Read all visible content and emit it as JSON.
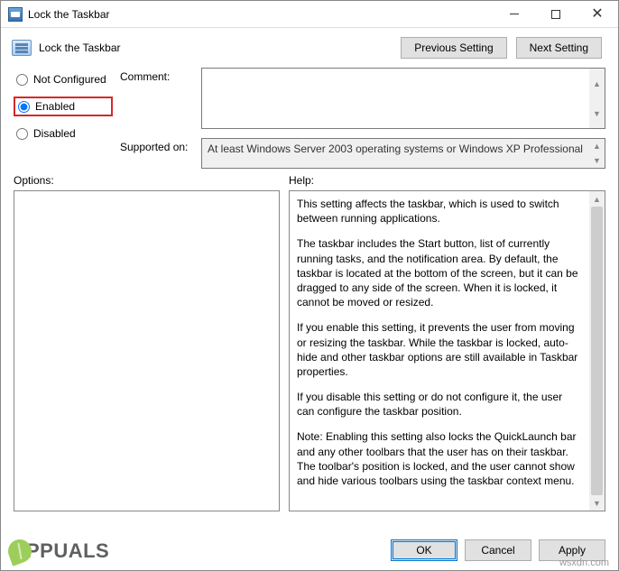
{
  "window": {
    "title": "Lock the Taskbar"
  },
  "header": {
    "policy_title": "Lock the Taskbar",
    "prev_label": "Previous Setting",
    "next_label": "Next Setting"
  },
  "state": {
    "not_configured": "Not Configured",
    "enabled": "Enabled",
    "disabled": "Disabled",
    "selected": "enabled"
  },
  "fields": {
    "comment_label": "Comment:",
    "comment_value": "",
    "supported_label": "Supported on:",
    "supported_value": "At least Windows Server 2003 operating systems or Windows XP Professional"
  },
  "sections": {
    "options_label": "Options:",
    "help_label": "Help:"
  },
  "help": {
    "p1": "This setting affects the taskbar, which is used to switch between running applications.",
    "p2": "The taskbar includes the Start button, list of currently running tasks, and the notification area. By default, the taskbar is located at the bottom of the screen, but it can be dragged to any side of the screen. When it is locked, it cannot be moved or resized.",
    "p3": "If you enable this setting, it prevents the user from moving or resizing the taskbar. While the taskbar is locked, auto-hide and other taskbar options are still available in Taskbar properties.",
    "p4": "If you disable this setting or do not configure it, the user can configure the taskbar position.",
    "p5": "Note: Enabling this setting also locks the QuickLaunch bar and any other toolbars that the user has on their taskbar. The toolbar's position is locked, and the user cannot show and hide various toolbars using the taskbar context menu."
  },
  "footer": {
    "ok": "OK",
    "cancel": "Cancel",
    "apply": "Apply"
  },
  "watermark": {
    "brand": "PPUALS",
    "site": "wsxdn.com"
  }
}
